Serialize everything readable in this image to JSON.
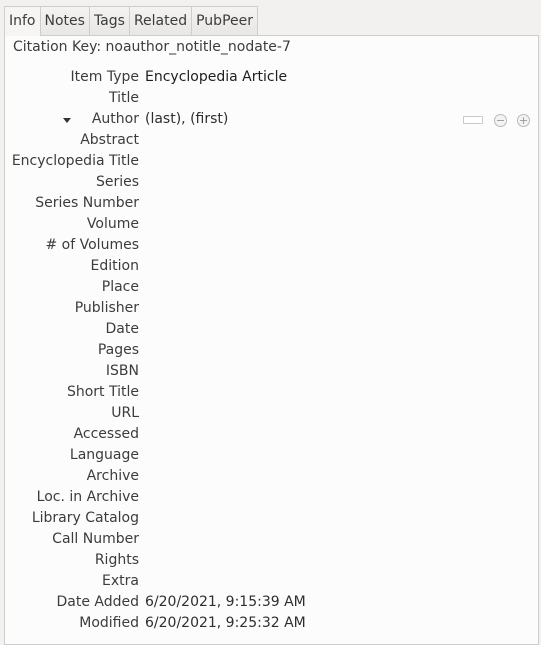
{
  "tabs": [
    "Info",
    "Notes",
    "Tags",
    "Related",
    "PubPeer"
  ],
  "citation_key": "Citation Key: noauthor_notitle_nodate-7",
  "item_type": {
    "label": "Item Type",
    "value": "Encyclopedia Article"
  },
  "title": {
    "label": "Title"
  },
  "author": {
    "label": "Author",
    "value": "(last), (first)"
  },
  "fields": [
    "Abstract",
    "Encyclopedia Title",
    "Series",
    "Series Number",
    "Volume",
    "# of Volumes",
    "Edition",
    "Place",
    "Publisher",
    "Date",
    "Pages",
    "ISBN",
    "Short Title",
    "URL",
    "Accessed",
    "Language",
    "Archive",
    "Loc. in Archive",
    "Library Catalog",
    "Call Number",
    "Rights",
    "Extra"
  ],
  "date_added": {
    "label": "Date Added",
    "value": "6/20/2021, 9:15:39 AM"
  },
  "modified": {
    "label": "Modified",
    "value": "6/20/2021, 9:25:32 AM"
  },
  "icons": {
    "remove": "minus-circle-icon",
    "add": "plus-circle-icon",
    "toggle": "disclosure-triangle-icon"
  }
}
